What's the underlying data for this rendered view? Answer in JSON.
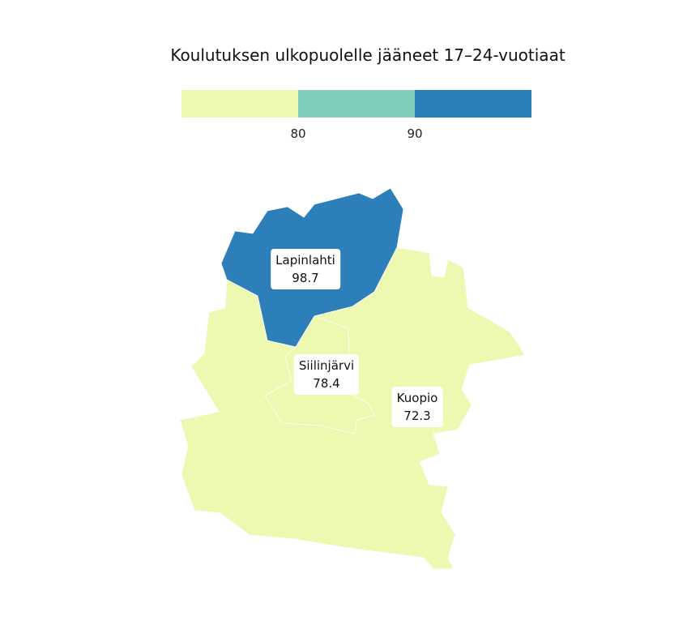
{
  "title": "Koulutuksen ulkopuolelle jääneet 17–24-vuotiaat",
  "legend": {
    "colors": [
      "#edf8b1",
      "#7fcdbb",
      "#2c7fb8"
    ],
    "thresholds": [
      80,
      90
    ],
    "tick_labels": [
      "80",
      "90"
    ]
  },
  "regions": [
    {
      "name": "Lapinlahti",
      "value": "98.7",
      "color": "#2c7fb8"
    },
    {
      "name": "Siilinjärvi",
      "value": "78.4",
      "color": "#edf8b1"
    },
    {
      "name": "Kuopio",
      "value": "72.3",
      "color": "#edf8b1"
    }
  ]
}
